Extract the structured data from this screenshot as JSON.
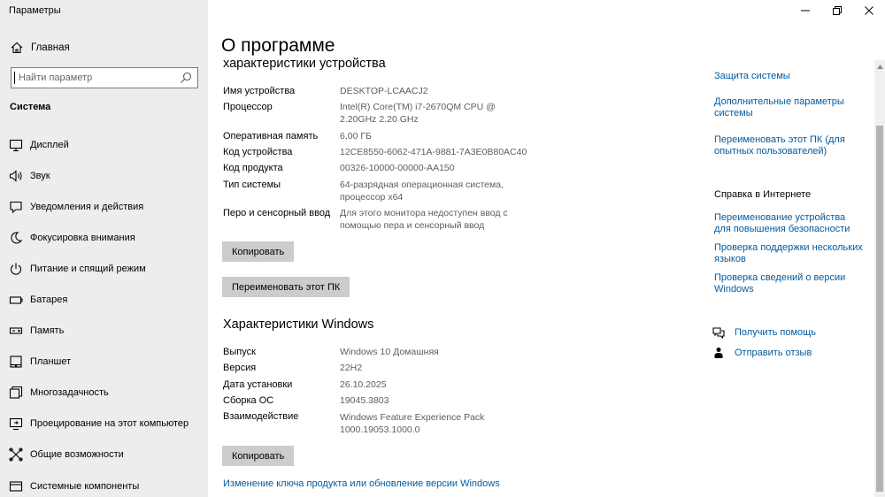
{
  "window": {
    "title": "Параметры"
  },
  "sidebar": {
    "home_label": "Главная",
    "search_placeholder": "Найти параметр",
    "section_title": "Система",
    "items": [
      {
        "label": "Дисплей",
        "icon": "display-icon"
      },
      {
        "label": "Звук",
        "icon": "speaker-icon"
      },
      {
        "label": "Уведомления и действия",
        "icon": "notification-icon"
      },
      {
        "label": "Фокусировка внимания",
        "icon": "moon-icon"
      },
      {
        "label": "Питание и спящий режим",
        "icon": "power-icon"
      },
      {
        "label": "Батарея",
        "icon": "battery-icon"
      },
      {
        "label": "Память",
        "icon": "storage-icon"
      },
      {
        "label": "Планшет",
        "icon": "tablet-icon"
      },
      {
        "label": "Многозадачность",
        "icon": "multitasking-icon"
      },
      {
        "label": "Проецирование на этот компьютер",
        "icon": "projecting-icon"
      },
      {
        "label": "Общие возможности",
        "icon": "shared-experiences-icon"
      },
      {
        "label": "Системные компоненты",
        "icon": "components-icon"
      }
    ]
  },
  "main": {
    "page_title": "О программе",
    "device_specs": {
      "heading": "характеристики устройства",
      "rows": [
        {
          "label": "Имя устройства",
          "value": "DESKTOP-LCAACJ2"
        },
        {
          "label": "Процессор",
          "value": "Intel(R) Core(TM) i7-2670QM CPU @ 2.20GHz   2.20 GHz"
        },
        {
          "label": "Оперативная память",
          "value": "6,00 ГБ"
        },
        {
          "label": "Код устройства",
          "value": "12CE8550-6062-471A-9881-7A3E0B80AC40"
        },
        {
          "label": "Код продукта",
          "value": "00326-10000-00000-AA150"
        },
        {
          "label": "Тип системы",
          "value": "64-разрядная операционная система, процессор x64"
        },
        {
          "label": "Перо и сенсорный ввод",
          "value": "Для этого монитора недоступен ввод с помощью пера и сенсорный ввод"
        }
      ],
      "copy_button": "Копировать",
      "rename_button": "Переименовать этот ПК"
    },
    "windows_specs": {
      "heading": "Характеристики Windows",
      "rows": [
        {
          "label": "Выпуск",
          "value": "Windows 10 Домашняя"
        },
        {
          "label": "Версия",
          "value": "22H2"
        },
        {
          "label": "Дата установки",
          "value": "26.10.2025"
        },
        {
          "label": "Сборка ОС",
          "value": "19045.3803"
        },
        {
          "label": "Взаимодействие",
          "value": "Windows Feature Experience Pack 1000.19053.1000.0"
        }
      ],
      "copy_button": "Копировать",
      "product_key_link": "Изменение ключа продукта или обновление версии Windows"
    }
  },
  "related": {
    "links": [
      "Защита системы",
      "Дополнительные параметры системы",
      "Переименовать этот ПК (для опытных пользователей)"
    ],
    "help_heading": "Справка в Интернете",
    "help_links": [
      "Переименование устройства для повышения безопасности",
      "Проверка поддержки нескольких языков",
      "Проверка сведений о версии Windows"
    ],
    "get_help": "Получить помощь",
    "feedback": "Отправить отзыв"
  },
  "colors": {
    "link": "#005a9e",
    "sidebar_bg": "#ededed",
    "button_bg": "#cccccc"
  }
}
